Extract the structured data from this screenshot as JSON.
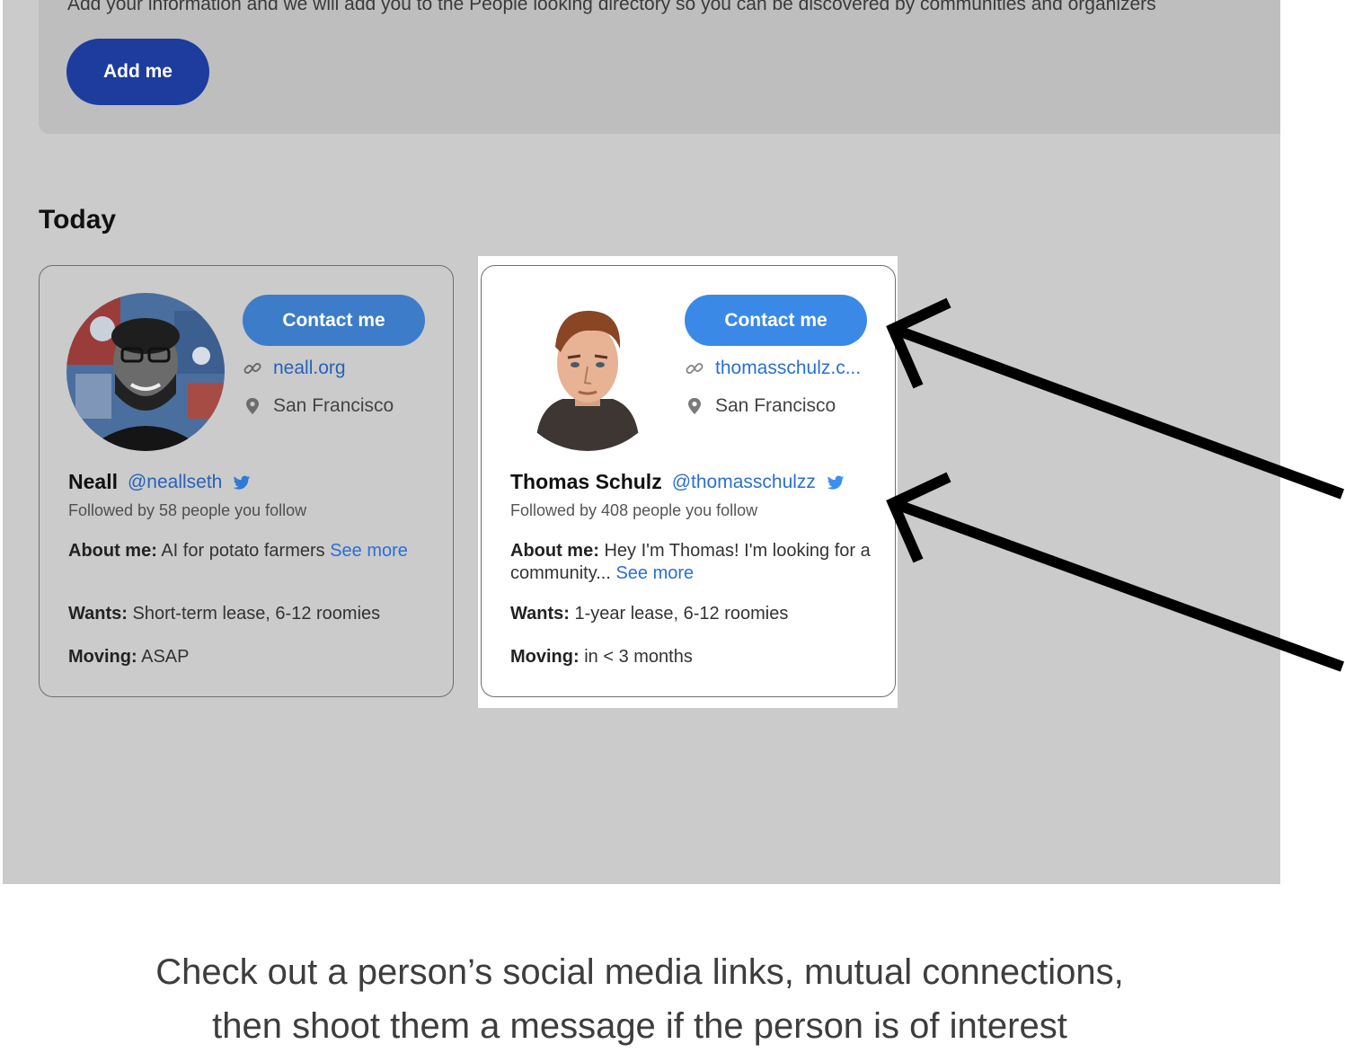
{
  "promo": {
    "text": "Add your information and we will add you to the People looking directory so you can be discovered by communities and organizers",
    "button_label": "Add me"
  },
  "section": {
    "title": "Today"
  },
  "people": [
    {
      "contact_label": "Contact me",
      "website": "neall.org",
      "location": "San Francisco",
      "name": "Neall",
      "handle": "@neallseth",
      "followed_by": "Followed by 58 people you follow",
      "about_label": "About me:",
      "about": " AI for potato farmers ",
      "see_more": "See more",
      "wants_label": "Wants:",
      "wants": " Short-term lease, 6-12 roomies",
      "moving_label": "Moving:",
      "moving": " ASAP"
    },
    {
      "contact_label": "Contact me",
      "website": "thomasschulz.c...",
      "location": "San Francisco",
      "name": "Thomas Schulz",
      "handle": "@thomasschulzz",
      "followed_by": "Followed by 408 people you follow",
      "about_label": "About me:",
      "about": " Hey I'm Thomas! I'm looking for a community... ",
      "see_more": "See more",
      "wants_label": "Wants:",
      "wants": " 1-year lease, 6-12 roomies",
      "moving_label": "Moving:",
      "moving": " in < 3 months"
    }
  ],
  "caption": {
    "line1": "Check out a person’s social media links, mutual connections,",
    "line2": "then shoot them a message if the person is of interest"
  },
  "icons": {
    "link": "link-icon",
    "location": "map-pin-icon",
    "twitter": "twitter-bird-icon",
    "arrow": "arrow-icon"
  },
  "colors": {
    "add_me_button": "#1d3c9e",
    "contact_button": "#3b89e6",
    "link": "#2a6fd6",
    "twitter": "#3b8ff0",
    "backdrop": "#cbcbcb"
  }
}
